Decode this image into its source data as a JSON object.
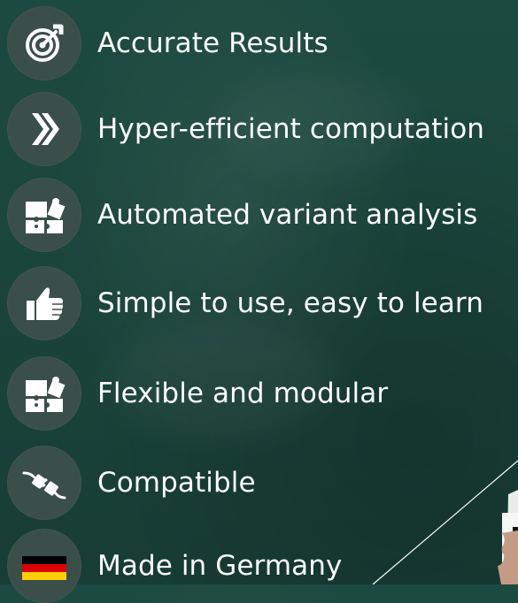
{
  "features": [
    {
      "label": "Accurate Results",
      "icon": "target-icon"
    },
    {
      "label": "Hyper-efficient computation",
      "icon": "double-chevron-right-icon"
    },
    {
      "label": "Automated variant analysis",
      "icon": "puzzle-icon"
    },
    {
      "label": "Simple to use, easy to learn",
      "icon": "thumbs-up-icon"
    },
    {
      "label": "Flexible and modular",
      "icon": "puzzle-icon"
    },
    {
      "label": "Compatible",
      "icon": "plug-icon"
    },
    {
      "label": "Made in Germany",
      "icon": "germany-flag-icon"
    }
  ],
  "colors": {
    "background": "#1a453b",
    "icon_circle": "#3a4f4a",
    "text": "#ffffff",
    "flag_black": "#000000",
    "flag_red": "#dd0000",
    "flag_gold": "#ffce00"
  }
}
